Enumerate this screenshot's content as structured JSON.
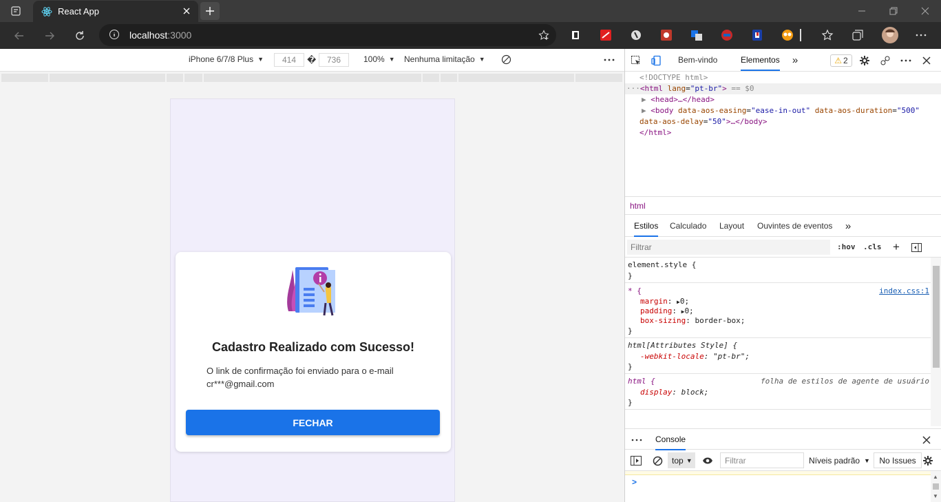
{
  "browser": {
    "tab_title": "React App",
    "url_host": "localhost",
    "url_port": ":3000"
  },
  "device_toolbar": {
    "device": "iPhone 6/7/8 Plus",
    "width": "414",
    "separator": "�",
    "height": "736",
    "zoom": "100%",
    "throttle": "Nenhuma limitação"
  },
  "app": {
    "card_title": "Cadastro Realizado com Sucesso!",
    "message_line1": "O link de confirmação foi enviado para o e-mail",
    "message_line2": "cr***@gmail.com",
    "button_label": "FECHAR"
  },
  "devtools": {
    "tabs": [
      "Bem-vindo",
      "Elementos"
    ],
    "warnings_count": "2",
    "dom": {
      "doctype": "<!DOCTYPE html>",
      "html_open_tag": "<html",
      "html_lang_attr": "lang",
      "html_lang_val": "\"pt-br\"",
      "html_sel_marker": "== $0",
      "head": "<head>…</head>",
      "body_attr1": "data-aos-easing",
      "body_val1": "\"ease-in-out\"",
      "body_attr2": "data-aos-duration",
      "body_val2": "\"500\"",
      "body_attr3": "data-aos-delay",
      "body_val3": "\"50\"",
      "body_close": ">…</body>",
      "html_close": "</html>"
    },
    "breadcrumb": "html",
    "subtabs": [
      "Estilos",
      "Calculado",
      "Layout",
      "Ouvintes de eventos"
    ],
    "filter_placeholder": "Filtrar",
    "hov": ":hov",
    "cls": ".cls",
    "styles": {
      "element_style": "element.style {",
      "close": "}",
      "star_selector": "* {",
      "star_source": "index.css:1",
      "margin_prop": "margin",
      "margin_val": "0;",
      "padding_prop": "padding",
      "padding_val": "0;",
      "boxsizing_prop": "box-sizing",
      "boxsizing_val": "border-box;",
      "attr_style_selector": "html[Attributes Style] {",
      "locale_prop": "-webkit-locale",
      "locale_val": "\"pt-br\";",
      "html_selector": "html {",
      "ua_source": "folha de estilos de agente de usuário",
      "display_prop": "display",
      "display_val": "block;"
    },
    "console": {
      "tab": "Console",
      "context": "top",
      "filter_placeholder": "Filtrar",
      "levels": "Níveis padrão",
      "issues": "No Issues",
      "prompt": ">"
    }
  }
}
